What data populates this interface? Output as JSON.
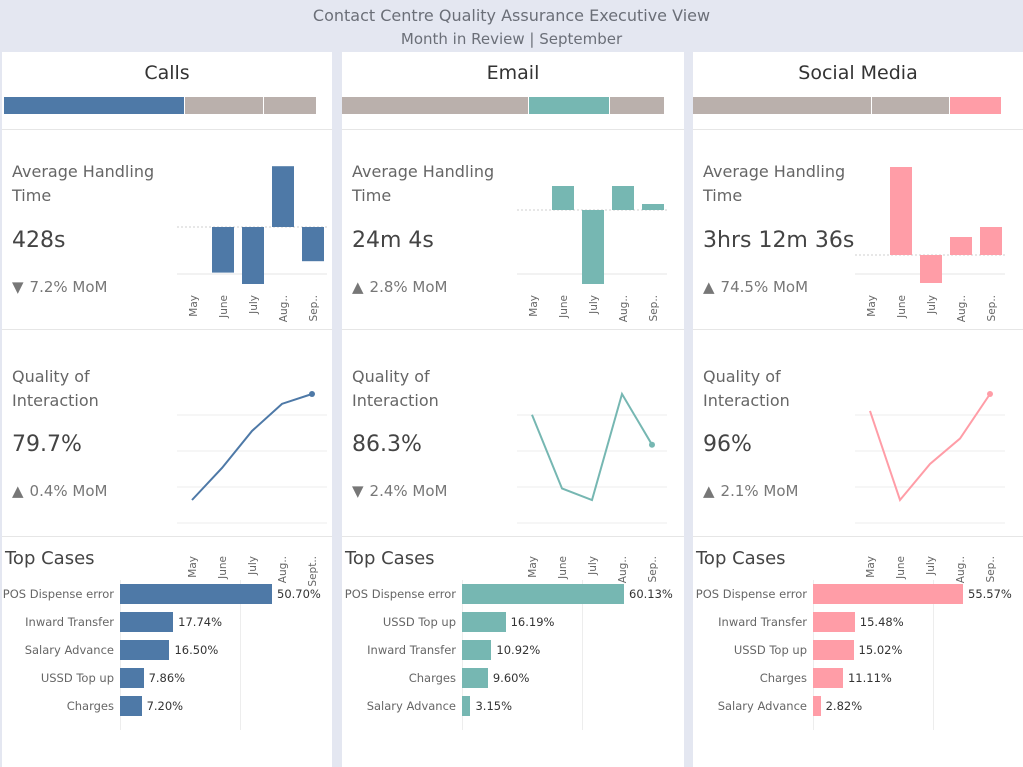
{
  "header": {
    "title": "Contact Centre Quality Assurance Executive View",
    "subtitle": "Month in Review | September"
  },
  "months": [
    "May",
    "June",
    "July",
    "Aug..",
    "Sep.."
  ],
  "qoi_months": {
    "calls": [
      "May",
      "June",
      "July",
      "Aug..",
      "Sept.."
    ],
    "email": [
      "May",
      "June",
      "July",
      "Aug..",
      "Sep.."
    ],
    "social": [
      "May",
      "June",
      "July",
      "Aug..",
      "Sep.."
    ]
  },
  "labels": {
    "aht": "Average Handling Time",
    "qoi": "Quality of Interaction",
    "top_cases": "Top Cases"
  },
  "channels": [
    {
      "key": "calls",
      "title": "Calls",
      "color": "#4e79a7",
      "segments": [
        {
          "share": 0.56,
          "color": "#4e79a7"
        },
        {
          "share": 0.245,
          "color": "#bab0ac"
        },
        {
          "share": 0.165,
          "color": "#bab0ac"
        }
      ],
      "aht": {
        "value": "428s",
        "delta": "7.2% MoM",
        "direction": "down"
      },
      "qoi": {
        "value": "79.7%",
        "delta": "0.4% MoM",
        "direction": "up"
      },
      "top_cases": [
        {
          "label": "POS Dispense error",
          "value": 50.7,
          "display": "50.70%"
        },
        {
          "label": "Inward Transfer",
          "value": 17.74,
          "display": "17.74%"
        },
        {
          "label": "Salary Advance",
          "value": 16.5,
          "display": "16.50%"
        },
        {
          "label": "USSD Top up",
          "value": 7.86,
          "display": "7.86%"
        },
        {
          "label": "Charges",
          "value": 7.2,
          "display": "7.20%"
        }
      ]
    },
    {
      "key": "email",
      "title": "Email",
      "color": "#76b7b2",
      "segments": [
        {
          "share": 0.555,
          "color": "#bab0ac"
        },
        {
          "share": 0.24,
          "color": "#76b7b2"
        },
        {
          "share": 0.165,
          "color": "#bab0ac"
        }
      ],
      "aht": {
        "value": "24m 4s",
        "delta": "2.8% MoM",
        "direction": "up"
      },
      "qoi": {
        "value": "86.3%",
        "delta": "2.4% MoM",
        "direction": "down"
      },
      "top_cases": [
        {
          "label": "POS Dispense error",
          "value": 60.13,
          "display": "60.13%"
        },
        {
          "label": "USSD Top up",
          "value": 16.19,
          "display": "16.19%"
        },
        {
          "label": "Inward Transfer",
          "value": 10.92,
          "display": "10.92%"
        },
        {
          "label": "Charges",
          "value": 9.6,
          "display": "9.60%"
        },
        {
          "label": "Salary Advance",
          "value": 3.15,
          "display": "3.15%"
        }
      ]
    },
    {
      "key": "social",
      "title": "Social Media",
      "color": "#ff9da7",
      "segments": [
        {
          "share": 0.55,
          "color": "#bab0ac"
        },
        {
          "share": 0.24,
          "color": "#bab0ac"
        },
        {
          "share": 0.16,
          "color": "#ff9da7"
        }
      ],
      "aht": {
        "value": "3hrs 12m 36s",
        "delta": "74.5% MoM",
        "direction": "up"
      },
      "qoi": {
        "value": "96%",
        "delta": "2.1% MoM",
        "direction": "up"
      },
      "top_cases": [
        {
          "label": "POS Dispense error",
          "value": 55.57,
          "display": "55.57%"
        },
        {
          "label": "Inward Transfer",
          "value": 15.48,
          "display": "15.48%"
        },
        {
          "label": "USSD Top up",
          "value": 15.02,
          "display": "15.02%"
        },
        {
          "label": "Charges",
          "value": 11.11,
          "display": "11.11%"
        },
        {
          "label": "Salary Advance",
          "value": 2.82,
          "display": "2.82%"
        }
      ]
    }
  ],
  "chart_data": [
    {
      "type": "bar",
      "title": "Calls - Average Handling Time",
      "subtype": "diverging",
      "categories": [
        "May",
        "June",
        "July",
        "Aug..",
        "Sep.."
      ],
      "values": [
        0,
        -24,
        -30,
        32,
        -18
      ]
    },
    {
      "type": "line",
      "title": "Calls - Quality of Interaction",
      "categories": [
        "May",
        "June",
        "July",
        "Aug..",
        "Sept.."
      ],
      "values": [
        75.4,
        76.7,
        78.2,
        79.3,
        79.7
      ]
    },
    {
      "type": "bar",
      "title": "Email - Average Handling Time",
      "subtype": "diverging",
      "categories": [
        "May",
        "June",
        "July",
        "Aug..",
        "Sep.."
      ],
      "values": [
        0,
        12,
        -37,
        12,
        3
      ]
    },
    {
      "type": "line",
      "title": "Email - Quality of Interaction",
      "categories": [
        "May",
        "June",
        "July",
        "Aug..",
        "Sep.."
      ],
      "values": [
        87.6,
        84.4,
        83.9,
        88.5,
        86.3
      ]
    },
    {
      "type": "bar",
      "title": "Social Media - Average Handling Time",
      "subtype": "diverging",
      "categories": [
        "May",
        "June",
        "July",
        "Aug..",
        "Sep.."
      ],
      "values": [
        0,
        44,
        -14,
        9,
        14
      ]
    },
    {
      "type": "line",
      "title": "Social Media - Quality of Interaction",
      "categories": [
        "May",
        "June",
        "July",
        "Aug..",
        "Sep.."
      ],
      "values": [
        95.2,
        91.0,
        92.7,
        93.9,
        96.0
      ]
    },
    {
      "type": "bar",
      "orientation": "horizontal",
      "title": "Calls - Top Cases",
      "categories": [
        "POS Dispense error",
        "Inward Transfer",
        "Salary Advance",
        "USSD Top up",
        "Charges"
      ],
      "values": [
        50.7,
        17.74,
        16.5,
        7.86,
        7.2
      ]
    },
    {
      "type": "bar",
      "orientation": "horizontal",
      "title": "Email - Top Cases",
      "categories": [
        "POS Dispense error",
        "USSD Top up",
        "Inward Transfer",
        "Charges",
        "Salary Advance"
      ],
      "values": [
        60.13,
        16.19,
        10.92,
        9.6,
        3.15
      ]
    },
    {
      "type": "bar",
      "orientation": "horizontal",
      "title": "Social Media - Top Cases",
      "categories": [
        "POS Dispense error",
        "Inward Transfer",
        "USSD Top up",
        "Charges",
        "Salary Advance"
      ],
      "values": [
        55.57,
        15.48,
        15.02,
        11.11,
        2.82
      ]
    }
  ]
}
